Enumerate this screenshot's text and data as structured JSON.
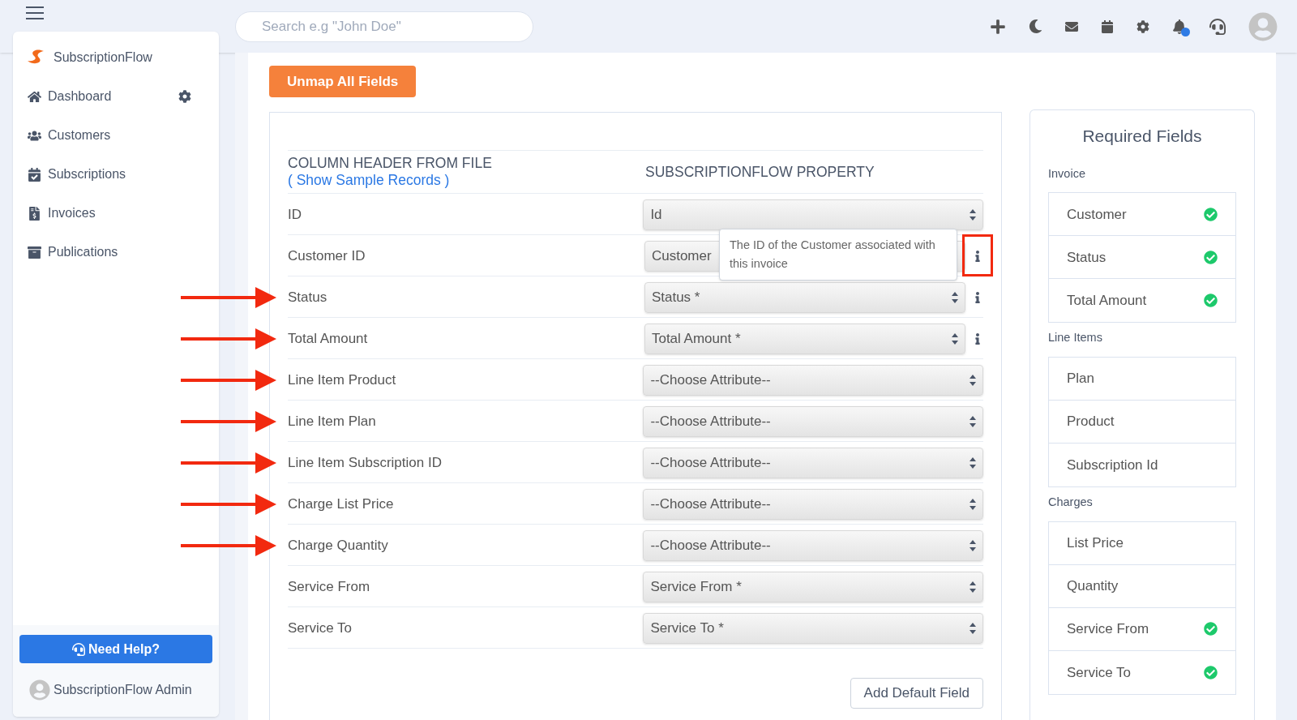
{
  "topbar": {
    "search_placeholder": "Search e.g \"John Doe\"",
    "notification_dot": true
  },
  "sidebar": {
    "brand": "SubscriptionFlow",
    "items": [
      {
        "label": "Dashboard",
        "settings": true
      },
      {
        "label": "Customers",
        "settings": false
      },
      {
        "label": "Subscriptions",
        "settings": false
      },
      {
        "label": "Invoices",
        "settings": false
      },
      {
        "label": "Publications",
        "settings": false
      }
    ],
    "help_button": "Need Help?",
    "user": "SubscriptionFlow Admin"
  },
  "unmap_button": "Unmap All Fields",
  "mapping": {
    "column_header": "COLUMN HEADER FROM FILE",
    "sample_link": "( Show Sample Records )",
    "property_header": "SUBSCRIPTIONFLOW PROPERTY",
    "rows": [
      {
        "label": "ID",
        "value": "Id",
        "info": false,
        "arrow": false,
        "highlighted": false
      },
      {
        "label": "Customer ID",
        "value": "Customer",
        "info": true,
        "arrow": false,
        "highlighted": true,
        "tooltip": "The ID of the Customer associated with this invoice"
      },
      {
        "label": "Status",
        "value": "Status *",
        "info": true,
        "arrow": true,
        "highlighted": false
      },
      {
        "label": "Total Amount",
        "value": "Total Amount *",
        "info": true,
        "arrow": true,
        "highlighted": false
      },
      {
        "label": "Line Item Product",
        "value": "--Choose Attribute--",
        "info": false,
        "arrow": true,
        "highlighted": false
      },
      {
        "label": "Line Item Plan",
        "value": "--Choose Attribute--",
        "info": false,
        "arrow": true,
        "highlighted": false
      },
      {
        "label": "Line Item Subscription ID",
        "value": "--Choose Attribute--",
        "info": false,
        "arrow": true,
        "highlighted": false
      },
      {
        "label": "Charge List Price",
        "value": "--Choose Attribute--",
        "info": false,
        "arrow": true,
        "highlighted": false
      },
      {
        "label": "Charge Quantity",
        "value": "--Choose Attribute--",
        "info": false,
        "arrow": true,
        "highlighted": false
      },
      {
        "label": "Service From",
        "value": "Service From *",
        "info": false,
        "arrow": false,
        "highlighted": false
      },
      {
        "label": "Service To",
        "value": "Service To *",
        "info": false,
        "arrow": false,
        "highlighted": false
      }
    ],
    "add_button": "Add Default Field"
  },
  "required": {
    "title": "Required Fields",
    "groups": [
      {
        "name": "Invoice",
        "items": [
          {
            "label": "Customer",
            "checked": true
          },
          {
            "label": "Status",
            "checked": true
          },
          {
            "label": "Total Amount",
            "checked": true
          }
        ]
      },
      {
        "name": "Line Items",
        "items": [
          {
            "label": "Plan",
            "checked": false
          },
          {
            "label": "Product",
            "checked": false
          },
          {
            "label": "Subscription Id",
            "checked": false
          }
        ]
      },
      {
        "name": "Charges",
        "items": [
          {
            "label": "List Price",
            "checked": false
          },
          {
            "label": "Quantity",
            "checked": false
          },
          {
            "label": "Service From",
            "checked": true
          },
          {
            "label": "Service To",
            "checked": true
          }
        ]
      }
    ]
  }
}
